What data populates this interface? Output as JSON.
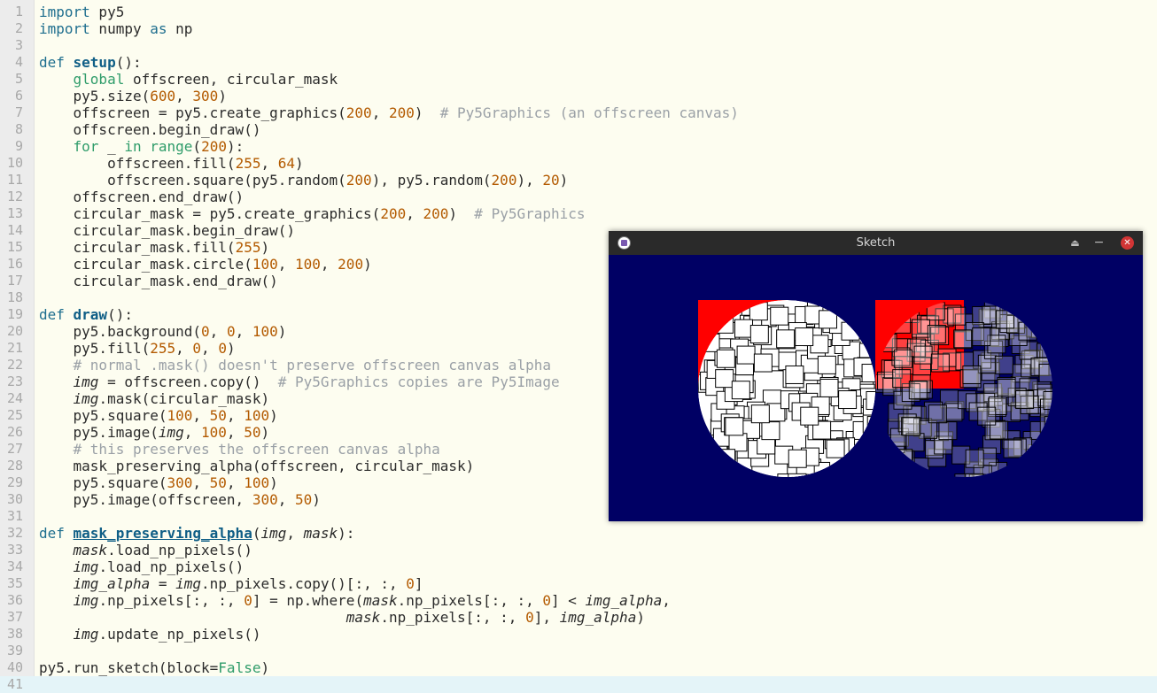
{
  "editor": {
    "lines": [
      {
        "n": "1",
        "s": [
          [
            "t-kw",
            "import"
          ],
          [
            "t-pl",
            " py5"
          ]
        ]
      },
      {
        "n": "2",
        "s": [
          [
            "t-kw",
            "import"
          ],
          [
            "t-pl",
            " numpy "
          ],
          [
            "t-kw",
            "as"
          ],
          [
            "t-pl",
            " np"
          ]
        ]
      },
      {
        "n": "3",
        "s": []
      },
      {
        "n": "4",
        "s": [
          [
            "t-kw",
            "def "
          ],
          [
            "t-fn",
            "setup"
          ],
          [
            "t-pl",
            "():"
          ]
        ]
      },
      {
        "n": "5",
        "s": [
          [
            "t-pl",
            "    "
          ],
          [
            "t-bi",
            "global"
          ],
          [
            "t-pl",
            " offscreen, circular_mask"
          ]
        ]
      },
      {
        "n": "6",
        "s": [
          [
            "t-pl",
            "    py5.size("
          ],
          [
            "t-num",
            "600"
          ],
          [
            "t-pl",
            ", "
          ],
          [
            "t-num",
            "300"
          ],
          [
            "t-pl",
            ")"
          ]
        ]
      },
      {
        "n": "7",
        "s": [
          [
            "t-pl",
            "    offscreen = py5.create_graphics("
          ],
          [
            "t-num",
            "200"
          ],
          [
            "t-pl",
            ", "
          ],
          [
            "t-num",
            "200"
          ],
          [
            "t-pl",
            ")  "
          ],
          [
            "t-com",
            "# Py5Graphics (an offscreen canvas)"
          ]
        ]
      },
      {
        "n": "8",
        "s": [
          [
            "t-pl",
            "    offscreen.begin_draw()"
          ]
        ]
      },
      {
        "n": "9",
        "s": [
          [
            "t-pl",
            "    "
          ],
          [
            "t-bi",
            "for"
          ],
          [
            "t-pl",
            " _ "
          ],
          [
            "t-bi",
            "in"
          ],
          [
            "t-pl",
            " "
          ],
          [
            "t-bi",
            "range"
          ],
          [
            "t-pl",
            "("
          ],
          [
            "t-num",
            "200"
          ],
          [
            "t-pl",
            "):"
          ]
        ]
      },
      {
        "n": "10",
        "s": [
          [
            "t-pl",
            "        offscreen.fill("
          ],
          [
            "t-num",
            "255"
          ],
          [
            "t-pl",
            ", "
          ],
          [
            "t-num",
            "64"
          ],
          [
            "t-pl",
            ")"
          ]
        ]
      },
      {
        "n": "11",
        "s": [
          [
            "t-pl",
            "        offscreen.square(py5.random("
          ],
          [
            "t-num",
            "200"
          ],
          [
            "t-pl",
            "), py5.random("
          ],
          [
            "t-num",
            "200"
          ],
          [
            "t-pl",
            "), "
          ],
          [
            "t-num",
            "20"
          ],
          [
            "t-pl",
            ")"
          ]
        ]
      },
      {
        "n": "12",
        "s": [
          [
            "t-pl",
            "    offscreen.end_draw()"
          ]
        ]
      },
      {
        "n": "13",
        "s": [
          [
            "t-pl",
            "    circular_mask = py5.create_graphics("
          ],
          [
            "t-num",
            "200"
          ],
          [
            "t-pl",
            ", "
          ],
          [
            "t-num",
            "200"
          ],
          [
            "t-pl",
            ")  "
          ],
          [
            "t-com",
            "# Py5Graphics"
          ]
        ]
      },
      {
        "n": "14",
        "s": [
          [
            "t-pl",
            "    circular_mask.begin_draw()"
          ]
        ]
      },
      {
        "n": "15",
        "s": [
          [
            "t-pl",
            "    circular_mask.fill("
          ],
          [
            "t-num",
            "255"
          ],
          [
            "t-pl",
            ")"
          ]
        ]
      },
      {
        "n": "16",
        "s": [
          [
            "t-pl",
            "    circular_mask.circle("
          ],
          [
            "t-num",
            "100"
          ],
          [
            "t-pl",
            ", "
          ],
          [
            "t-num",
            "100"
          ],
          [
            "t-pl",
            ", "
          ],
          [
            "t-num",
            "200"
          ],
          [
            "t-pl",
            ")"
          ]
        ]
      },
      {
        "n": "17",
        "s": [
          [
            "t-pl",
            "    circular_mask.end_draw()"
          ]
        ]
      },
      {
        "n": "18",
        "s": []
      },
      {
        "n": "19",
        "s": [
          [
            "t-kw",
            "def "
          ],
          [
            "t-fn",
            "draw"
          ],
          [
            "t-pl",
            "():"
          ]
        ]
      },
      {
        "n": "20",
        "s": [
          [
            "t-pl",
            "    py5.background("
          ],
          [
            "t-num",
            "0"
          ],
          [
            "t-pl",
            ", "
          ],
          [
            "t-num",
            "0"
          ],
          [
            "t-pl",
            ", "
          ],
          [
            "t-num",
            "100"
          ],
          [
            "t-pl",
            ")"
          ]
        ]
      },
      {
        "n": "21",
        "s": [
          [
            "t-pl",
            "    py5.fill("
          ],
          [
            "t-num",
            "255"
          ],
          [
            "t-pl",
            ", "
          ],
          [
            "t-num",
            "0"
          ],
          [
            "t-pl",
            ", "
          ],
          [
            "t-num",
            "0"
          ],
          [
            "t-pl",
            ")"
          ]
        ]
      },
      {
        "n": "22",
        "s": [
          [
            "t-pl",
            "    "
          ],
          [
            "t-com",
            "# normal .mask() doesn't preserve offscreen canvas alpha"
          ]
        ]
      },
      {
        "n": "23",
        "s": [
          [
            "t-pl",
            "    "
          ],
          [
            "t-it",
            "img"
          ],
          [
            "t-pl",
            " = offscreen.copy()  "
          ],
          [
            "t-com",
            "# Py5Graphics copies are Py5Image"
          ]
        ]
      },
      {
        "n": "24",
        "s": [
          [
            "t-pl",
            "    "
          ],
          [
            "t-it",
            "img"
          ],
          [
            "t-pl",
            ".mask(circular_mask)"
          ]
        ]
      },
      {
        "n": "25",
        "s": [
          [
            "t-pl",
            "    py5.square("
          ],
          [
            "t-num",
            "100"
          ],
          [
            "t-pl",
            ", "
          ],
          [
            "t-num",
            "50"
          ],
          [
            "t-pl",
            ", "
          ],
          [
            "t-num",
            "100"
          ],
          [
            "t-pl",
            ")"
          ]
        ]
      },
      {
        "n": "26",
        "s": [
          [
            "t-pl",
            "    py5.image("
          ],
          [
            "t-it",
            "img"
          ],
          [
            "t-pl",
            ", "
          ],
          [
            "t-num",
            "100"
          ],
          [
            "t-pl",
            ", "
          ],
          [
            "t-num",
            "50"
          ],
          [
            "t-pl",
            ")"
          ]
        ]
      },
      {
        "n": "27",
        "s": [
          [
            "t-pl",
            "    "
          ],
          [
            "t-com",
            "# this preserves the offscreen canvas alpha"
          ]
        ]
      },
      {
        "n": "28",
        "s": [
          [
            "t-pl",
            "    mask_preserving_alpha(offscreen, circular_mask)"
          ]
        ]
      },
      {
        "n": "29",
        "s": [
          [
            "t-pl",
            "    py5.square("
          ],
          [
            "t-num",
            "300"
          ],
          [
            "t-pl",
            ", "
          ],
          [
            "t-num",
            "50"
          ],
          [
            "t-pl",
            ", "
          ],
          [
            "t-num",
            "100"
          ],
          [
            "t-pl",
            ")"
          ]
        ]
      },
      {
        "n": "30",
        "s": [
          [
            "t-pl",
            "    py5.image(offscreen, "
          ],
          [
            "t-num",
            "300"
          ],
          [
            "t-pl",
            ", "
          ],
          [
            "t-num",
            "50"
          ],
          [
            "t-pl",
            ")"
          ]
        ]
      },
      {
        "n": "31",
        "s": []
      },
      {
        "n": "32",
        "s": [
          [
            "t-kw",
            "def "
          ],
          [
            "t-fnu",
            "mask_preserving_alpha"
          ],
          [
            "t-pl",
            "("
          ],
          [
            "t-it",
            "img"
          ],
          [
            "t-pl",
            ", "
          ],
          [
            "t-it",
            "mask"
          ],
          [
            "t-pl",
            "):"
          ]
        ]
      },
      {
        "n": "33",
        "s": [
          [
            "t-pl",
            "    "
          ],
          [
            "t-it",
            "mask"
          ],
          [
            "t-pl",
            ".load_np_pixels()"
          ]
        ]
      },
      {
        "n": "34",
        "s": [
          [
            "t-pl",
            "    "
          ],
          [
            "t-it",
            "img"
          ],
          [
            "t-pl",
            ".load_np_pixels()"
          ]
        ]
      },
      {
        "n": "35",
        "s": [
          [
            "t-pl",
            "    "
          ],
          [
            "t-it",
            "img_alpha"
          ],
          [
            "t-pl",
            " = "
          ],
          [
            "t-it",
            "img"
          ],
          [
            "t-pl",
            ".np_pixels.copy()[:, :, "
          ],
          [
            "t-num",
            "0"
          ],
          [
            "t-pl",
            "]"
          ]
        ]
      },
      {
        "n": "36",
        "s": [
          [
            "t-pl",
            "    "
          ],
          [
            "t-it",
            "img"
          ],
          [
            "t-pl",
            ".np_pixels[:, :, "
          ],
          [
            "t-num",
            "0"
          ],
          [
            "t-pl",
            "] = np.where("
          ],
          [
            "t-it",
            "mask"
          ],
          [
            "t-pl",
            ".np_pixels[:, :, "
          ],
          [
            "t-num",
            "0"
          ],
          [
            "t-pl",
            "] < "
          ],
          [
            "t-it",
            "img_alpha"
          ],
          [
            "t-pl",
            ","
          ]
        ]
      },
      {
        "n": "37",
        "s": [
          [
            "t-pl",
            "                                    "
          ],
          [
            "t-it",
            "mask"
          ],
          [
            "t-pl",
            ".np_pixels[:, :, "
          ],
          [
            "t-num",
            "0"
          ],
          [
            "t-pl",
            "], "
          ],
          [
            "t-it",
            "img_alpha"
          ],
          [
            "t-pl",
            ")"
          ]
        ]
      },
      {
        "n": "38",
        "s": [
          [
            "t-pl",
            "    "
          ],
          [
            "t-it",
            "img"
          ],
          [
            "t-pl",
            ".update_np_pixels()"
          ]
        ]
      },
      {
        "n": "39",
        "s": []
      },
      {
        "n": "40",
        "s": [
          [
            "t-pl",
            "py5.run_sketch(block="
          ],
          [
            "t-bi",
            "False"
          ],
          [
            "t-pl",
            ")"
          ]
        ]
      },
      {
        "n": "41",
        "s": []
      }
    ],
    "current_line": "41"
  },
  "sketch_window": {
    "title": "Sketch",
    "icons": {
      "app": "py5-app-icon",
      "shade": "shade-icon",
      "minimize": "minimize-icon",
      "close": "close-icon"
    },
    "glyphs": {
      "shade": "⏏",
      "minimize": "−",
      "close": "✕"
    },
    "background": "#000064",
    "square_fill": "#ff0000",
    "tile_fill_opaque": "#ffffff",
    "tile_fill_translucent": "rgba(255,255,255,0.25)"
  }
}
